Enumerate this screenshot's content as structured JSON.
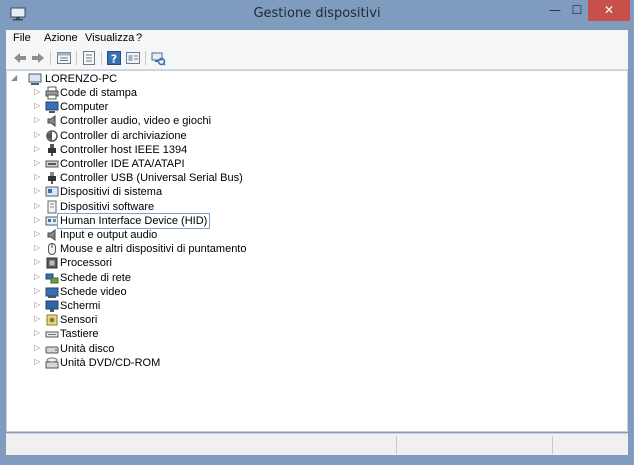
{
  "window": {
    "title": "Gestione dispositivi",
    "controls": {
      "minimize": "—",
      "maximize": "☐",
      "close": "✕"
    }
  },
  "menu": [
    "File",
    "Azione",
    "Visualizza",
    "?"
  ],
  "toolbar": {
    "buttons": [
      "back-icon",
      "forward-icon",
      "properties-view-icon",
      "update-driver-icon",
      "help-icon",
      "details-icon",
      "scan-hardware-icon"
    ]
  },
  "tree": {
    "root": {
      "label": "LORENZO-PC",
      "expanded": true
    },
    "selected_index": 9,
    "items": [
      {
        "label": "Code di stampa",
        "icon": "printer-icon"
      },
      {
        "label": "Computer",
        "icon": "computer-icon"
      },
      {
        "label": "Controller audio, video e giochi",
        "icon": "audio-controller-icon"
      },
      {
        "label": "Controller di archiviazione",
        "icon": "storage-controller-icon"
      },
      {
        "label": "Controller host IEEE 1394",
        "icon": "ieee1394-icon"
      },
      {
        "label": "Controller IDE ATA/ATAPI",
        "icon": "ide-controller-icon"
      },
      {
        "label": "Controller USB (Universal Serial Bus)",
        "icon": "usb-icon"
      },
      {
        "label": "Dispositivi di sistema",
        "icon": "system-devices-icon"
      },
      {
        "label": "Dispositivi software",
        "icon": "software-devices-icon"
      },
      {
        "label": "Human Interface Device (HID)",
        "icon": "hid-icon"
      },
      {
        "label": "Input e output audio",
        "icon": "audio-io-icon"
      },
      {
        "label": "Mouse e altri dispositivi di puntamento",
        "icon": "mouse-icon"
      },
      {
        "label": "Processori",
        "icon": "processor-icon"
      },
      {
        "label": "Schede di rete",
        "icon": "network-adapter-icon"
      },
      {
        "label": "Schede video",
        "icon": "display-adapter-icon"
      },
      {
        "label": "Schermi",
        "icon": "monitor-icon"
      },
      {
        "label": "Sensori",
        "icon": "sensor-icon"
      },
      {
        "label": "Tastiere",
        "icon": "keyboard-icon"
      },
      {
        "label": "Unità disco",
        "icon": "disk-drive-icon"
      },
      {
        "label": "Unità DVD/CD-ROM",
        "icon": "dvd-drive-icon"
      }
    ]
  },
  "colors": {
    "frame": "#7f9cbe",
    "close": "#c7504b",
    "selection_border": "#7da2ce"
  }
}
